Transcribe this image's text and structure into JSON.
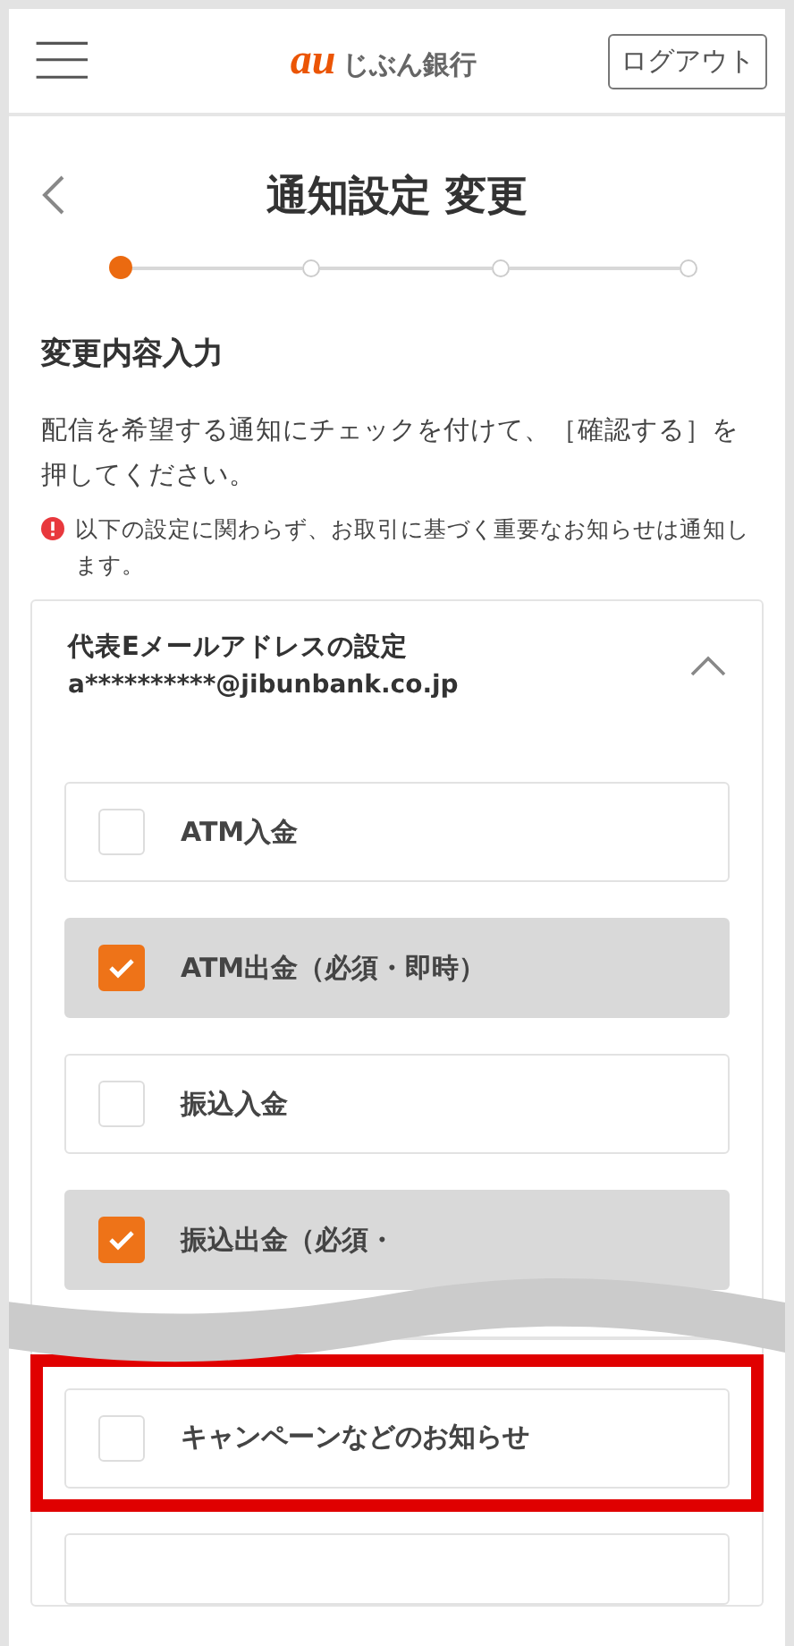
{
  "header": {
    "logo_mark": "au",
    "logo_text": "じぶん銀行",
    "logout_button": "ログアウト"
  },
  "page_title": "通知設定 変更",
  "steps": [
    {
      "selected": true
    },
    {
      "selected": false
    },
    {
      "selected": false
    },
    {
      "selected": false
    }
  ],
  "section_title": "変更内容入力",
  "instruction": "配信を希望する通知にチェックを付けて、［確認する］を押してください。",
  "notice": "以下の設定に関わらず、お取引に基づく重要なお知らせは通知します。",
  "card": {
    "title": "代表Eメールアドレスの設定",
    "email": "a**********@jibunbank.co.jp",
    "expanded": true,
    "options": [
      {
        "label": "ATM入金",
        "checked": false
      },
      {
        "label": "ATM出金（必須・即時）",
        "checked": true
      },
      {
        "label": "振込入金",
        "checked": false
      },
      {
        "label": "振込出金（必須・",
        "checked": true
      }
    ]
  },
  "highlighted_option": {
    "label": "キャンペーンなどのお知らせ",
    "checked": false
  }
}
